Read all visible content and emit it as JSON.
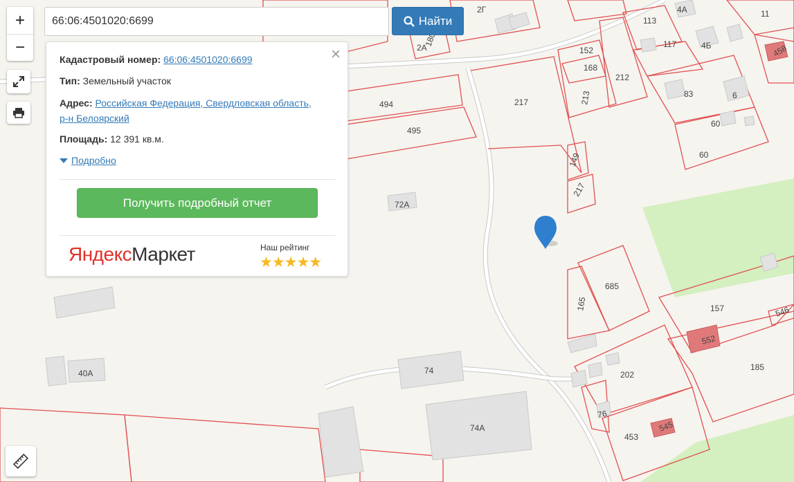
{
  "search": {
    "value": "66:06:4501020:6699",
    "button_label": "Найти"
  },
  "zoom": {
    "in_label": "+",
    "out_label": "−"
  },
  "card": {
    "cadastral_label": "Кадастровый номер:",
    "cadastral_value": "66:06:4501020:6699",
    "type_label": "Тип:",
    "type_value": "Земельный участок",
    "address_label": "Адрес:",
    "address_line1": "Российская Федерация, Свердловская область,",
    "address_line2": "р-н Белоярский",
    "area_label": "Площадь:",
    "area_value": "12 391 кв.м.",
    "more_label": "Подробно",
    "report_button": "Получить подробный отчет",
    "ad_brand_part1": "Яндекс",
    "ad_brand_part2": "Маркет",
    "rating_label": "Наш рейтинг",
    "rating_stars": 5
  },
  "map_labels": {
    "p494": "494",
    "p495": "495",
    "p72a": "72А",
    "p217a": "217",
    "p217b": "217",
    "p149": "149",
    "p152": "152",
    "p168": "168",
    "p213": "213",
    "p212": "212",
    "p113": "113",
    "p117": "117",
    "p4b": "4Б",
    "p4a": "4А",
    "p2g": "2Г",
    "p2a": "2А",
    "p180": "180",
    "p11": "11",
    "p458": "458",
    "p83": "83",
    "p6": "6",
    "p60a": "60",
    "p60b": "60",
    "p685": "685",
    "p165": "165",
    "p157": "157",
    "p546": "546",
    "p552": "552",
    "p185": "185",
    "p202": "202",
    "p76": "76",
    "p453": "453",
    "p545": "545",
    "p74": "74",
    "p74a": "74А",
    "p40a": "40А"
  },
  "colors": {
    "plot_border": "#e05050",
    "green_zone": "#d4efc0",
    "marker": "#2f7fcf",
    "button_blue": "#337ab7",
    "button_green": "#5cb85c"
  }
}
